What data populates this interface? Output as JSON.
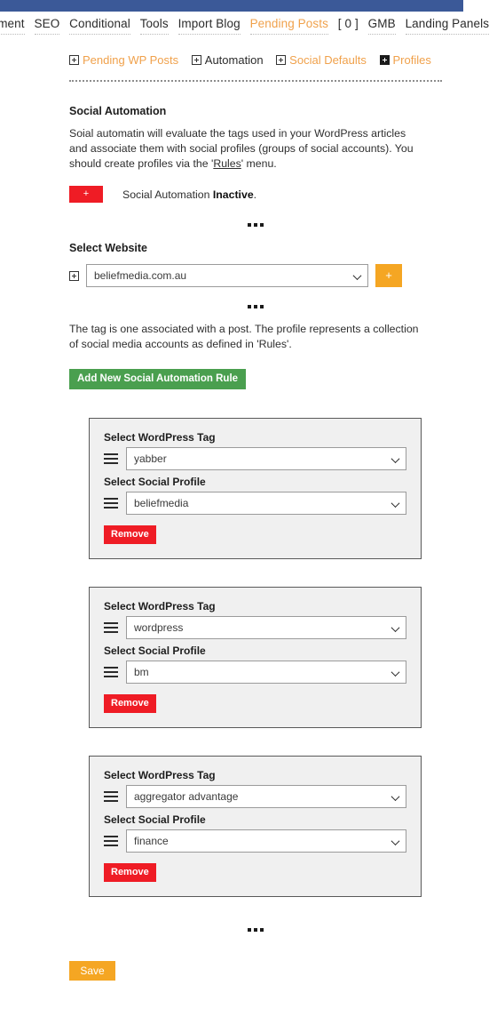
{
  "theme": {
    "topbar_color": "#3b5998",
    "accent_orange": "#f0a14b",
    "button_orange": "#f5a623",
    "button_green": "#4a9f4f",
    "button_red": "#ef1c25",
    "card_bg": "#f0f0f0"
  },
  "main_nav": {
    "items": [
      {
        "label": "gement",
        "accent": false,
        "truncated": true
      },
      {
        "label": "SEO",
        "accent": false
      },
      {
        "label": "Conditional",
        "accent": false
      },
      {
        "label": "Tools",
        "accent": false
      },
      {
        "label": "Import Blog",
        "accent": false
      },
      {
        "label": "Pending Posts",
        "accent": true
      },
      {
        "label": "[ 0 ]",
        "accent": false,
        "plain": true
      },
      {
        "label": "GMB",
        "accent": false
      },
      {
        "label": "Landing Panels",
        "accent": false
      }
    ],
    "chart_glyph": "ᐅ▂"
  },
  "sub_nav": {
    "items": [
      {
        "label": "Pending WP Posts",
        "accent": true,
        "icon": "plus-square-icon",
        "icon_filled": false
      },
      {
        "label": "Automation",
        "accent": false,
        "icon": "plus-square-icon",
        "icon_filled": false
      },
      {
        "label": "Social Defaults",
        "accent": true,
        "icon": "plus-square-icon",
        "icon_filled": false
      },
      {
        "label": "Profiles",
        "accent": true,
        "icon": "plus-square-filled-icon",
        "icon_filled": true
      }
    ]
  },
  "section": {
    "title": "Social Automation",
    "description_a": "Soial automatin will evaluate the tags used in your WordPress articles and associate them with social profiles (groups of social accounts). You should create profiles via the '",
    "description_link": "Rules",
    "description_b": "' menu."
  },
  "status": {
    "toggle_label": "+",
    "text_prefix": "Social Automation ",
    "state": "Inactive",
    "text_suffix": "."
  },
  "website": {
    "label": "Select Website",
    "selected": "beliefmedia.com.au",
    "options": [
      "beliefmedia.com.au"
    ],
    "add_label": "+",
    "expand_icon": "plus-square-icon"
  },
  "rules_intro": {
    "text": "The tag is one associated with a post. The profile represents a collection of social media accounts as defined in 'Rules'.",
    "add_button": "Add New Social Automation Rule"
  },
  "rules": {
    "tag_label": "Select WordPress Tag",
    "profile_label": "Select Social Profile",
    "remove_label": "Remove",
    "items": [
      {
        "tag": "yabber",
        "profile": "beliefmedia"
      },
      {
        "tag": "wordpress",
        "profile": "bm"
      },
      {
        "tag": "aggregator advantage",
        "profile": "finance"
      }
    ]
  },
  "footer": {
    "save_label": "Save"
  }
}
